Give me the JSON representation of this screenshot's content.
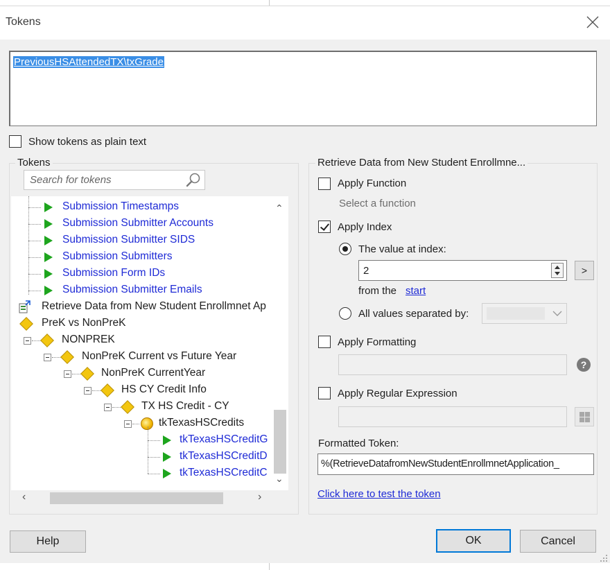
{
  "window": {
    "title": "Tokens"
  },
  "editor": {
    "token_text": "PreviousHSAttendedTX\\txGrade"
  },
  "show_plain_text": {
    "label": "Show tokens as plain text",
    "checked": false
  },
  "tokens_panel": {
    "caption": "Tokens",
    "search_placeholder": "Search for tokens",
    "tree": [
      {
        "label": "Submission Timestamps",
        "icon": "play-icon",
        "style": "link"
      },
      {
        "label": "Submission Submitter Accounts",
        "icon": "play-icon",
        "style": "link"
      },
      {
        "label": "Submission Submitter SIDS",
        "icon": "play-icon",
        "style": "link"
      },
      {
        "label": "Submission Submitters",
        "icon": "play-icon",
        "style": "link"
      },
      {
        "label": "Submission Form IDs",
        "icon": "play-icon",
        "style": "link"
      },
      {
        "label": "Submission Submitter Emails",
        "icon": "play-icon",
        "style": "link"
      },
      {
        "label": "Retrieve Data from New Student Enrollmnet Ap",
        "icon": "retrieve-data-icon",
        "style": "plain"
      },
      {
        "label": "PreK vs NonPreK",
        "icon": "decision-diamond-icon",
        "style": "plain"
      },
      {
        "label": "NONPREK",
        "icon": "decision-diamond-icon",
        "style": "plain"
      },
      {
        "label": "NonPreK Current vs Future Year",
        "icon": "decision-diamond-icon",
        "style": "plain"
      },
      {
        "label": "NonPreK CurrentYear",
        "icon": "decision-diamond-icon",
        "style": "plain"
      },
      {
        "label": "HS CY Credit Info",
        "icon": "decision-diamond-icon",
        "style": "plain"
      },
      {
        "label": "TX HS Credit - CY",
        "icon": "decision-diamond-icon",
        "style": "plain"
      },
      {
        "label": "tkTexasHSCredits",
        "icon": "coin-icon",
        "style": "plain"
      },
      {
        "label": "tkTexasHSCreditG",
        "icon": "play-icon",
        "style": "link"
      },
      {
        "label": "tkTexasHSCreditD",
        "icon": "play-icon",
        "style": "link"
      },
      {
        "label": "tkTexasHSCreditC",
        "icon": "play-icon",
        "style": "link"
      }
    ]
  },
  "retrieve_panel": {
    "caption": "Retrieve Data from New Student Enrollmne...",
    "apply_function": {
      "label": "Apply Function",
      "checked": false,
      "hint": "Select a function"
    },
    "apply_index": {
      "label": "Apply Index",
      "checked": true,
      "value_at_index_label": "The value at index:",
      "value_at_index_selected": true,
      "index_value": "2",
      "more_button": ">",
      "from_the_label": "from the",
      "from_the_link": "start",
      "all_values_label": "All values separated by:",
      "all_values_selected": false
    },
    "apply_formatting": {
      "label": "Apply Formatting",
      "checked": false,
      "help": "?"
    },
    "apply_regex": {
      "label": "Apply Regular Expression",
      "checked": false
    },
    "formatted_token": {
      "label": "Formatted Token:",
      "value": "%(RetrieveDatafromNewStudentEnrollmnetApplication_"
    },
    "test_link": "Click here to test the token"
  },
  "buttons": {
    "help": "Help",
    "ok": "OK",
    "cancel": "Cancel"
  }
}
